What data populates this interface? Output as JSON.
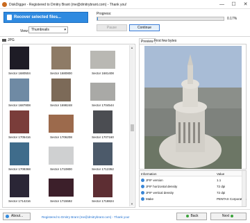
{
  "window": {
    "title": "DiskDigger - Registered to Dmitry Brant (me@dmitrybrant.com) - Thank you!",
    "minimize_glyph": "—",
    "maximize_glyph": "☐",
    "close_glyph": "✕",
    "icon": "diskdigger-app-icon"
  },
  "toolbar": {
    "recover_label": "Recover selected files...",
    "view_label": "View:",
    "view_value": "Thumbnails",
    "view_arrow": "▾"
  },
  "progress": {
    "label": "Progress:",
    "value": 0.17,
    "percent_text": "0.17%",
    "pause_label": "Pause",
    "continue_label": "Continue"
  },
  "folder": {
    "label": "JPG"
  },
  "thumbnails": [
    {
      "caption": "Sector 1680504",
      "color": "#1e1c26",
      "orientation": "portrait"
    },
    {
      "caption": "Sector 1680800",
      "color": "#8e7b66",
      "orientation": "portrait"
    },
    {
      "caption": "Sector 1681408",
      "color": "#b9b8b3",
      "orientation": "landscape"
    },
    {
      "caption": "Sector 1687808",
      "color": "#6f8aa4",
      "orientation": "portrait"
    },
    {
      "caption": "Sector 1698248",
      "color": "#7c6a58",
      "orientation": "portrait"
    },
    {
      "caption": "Sector 1704544",
      "color": "#a9a9a6",
      "orientation": "landscape"
    },
    {
      "caption": "Sector 1705416",
      "color": "#7a3d3a",
      "orientation": "portrait"
    },
    {
      "caption": "Sector 1706208",
      "color": "#9c6a4c",
      "orientation": "landscape"
    },
    {
      "caption": "Sector 1707160",
      "color": "#4b4d52",
      "orientation": "portrait"
    },
    {
      "caption": "Sector 1708368",
      "color": "#3f6c8b",
      "orientation": "portrait"
    },
    {
      "caption": "Sector 1710800",
      "color": "#cfd0d1",
      "orientation": "landscape"
    },
    {
      "caption": "Sector 1712352",
      "color": "#4c5a6a",
      "orientation": "portrait"
    },
    {
      "caption": "Sector 1714216",
      "color": "#2a2636",
      "orientation": "portrait"
    },
    {
      "caption": "Sector 1715592",
      "color": "#3c1f2a",
      "orientation": "landscape"
    },
    {
      "caption": "Sector 1718824",
      "color": "#5d2e33",
      "orientation": "portrait"
    }
  ],
  "preview": {
    "tabs": [
      "Preview",
      "First few bytes"
    ],
    "active_tab": "Preview",
    "sky_color": "#a8bcd6",
    "city_color": "#8b8f8a",
    "dome_color": "#d9d6cf"
  },
  "info": {
    "headers": [
      "Information",
      "Value"
    ],
    "rows": [
      {
        "key": "JFIF version",
        "value": "1.1"
      },
      {
        "key": "JFIF horizontal density",
        "value": "72 dpi"
      },
      {
        "key": "JFIF vertical density",
        "value": "72 dpi"
      },
      {
        "key": "Make",
        "value": "PENTAX Corporation"
      }
    ]
  },
  "bottom": {
    "about_label": "About...",
    "registration_text": "Registered to Dmitry Brant (me@dmitrybrant.com) - Thank you!",
    "back_label": "Back",
    "next_label": "Next"
  },
  "colors": {
    "accent": "#2f8ae0",
    "link": "#1e6fd0"
  }
}
